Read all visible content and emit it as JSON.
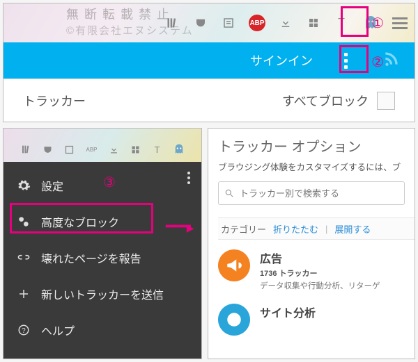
{
  "watermark": {
    "line1": "無断転載禁止",
    "line2": "©有限会社エヌシステム"
  },
  "annotations": {
    "one": "①",
    "two": "②",
    "three": "③"
  },
  "topbar": {
    "icons": [
      "library",
      "pocket",
      "reader",
      "abp",
      "download",
      "tile",
      "text",
      "ghostery",
      "menu"
    ],
    "abp_label": "ABP"
  },
  "bluebar": {
    "signin": "サインイン"
  },
  "tracker_row": {
    "left": "トラッカー",
    "right": "すべてブロック"
  },
  "dark_menu": {
    "items": [
      {
        "icon": "gear",
        "label": "設定"
      },
      {
        "icon": "gears",
        "label": "高度なブロック"
      },
      {
        "icon": "link",
        "label": "壊れたページを報告"
      },
      {
        "icon": "plus",
        "label": "新しいトラッカーを送信"
      },
      {
        "icon": "help",
        "label": "ヘルプ"
      }
    ]
  },
  "options": {
    "title": "トラッカー オプション",
    "subtitle": "ブラウジング体験をカスタマイズするには、ブ",
    "search_placeholder": "トラッカー別で検索する",
    "cat_label": "カテゴリー",
    "collapse": "折りたたむ",
    "expand": "展開する",
    "categories": [
      {
        "name": "広告",
        "count_label": "1736 トラッカー",
        "desc": "データ収集や行動分析、リターゲ",
        "color": "ad",
        "glyph": "megaphone"
      },
      {
        "name": "サイト分析",
        "count_label": "",
        "desc": "",
        "color": "an",
        "glyph": "pie"
      }
    ]
  }
}
